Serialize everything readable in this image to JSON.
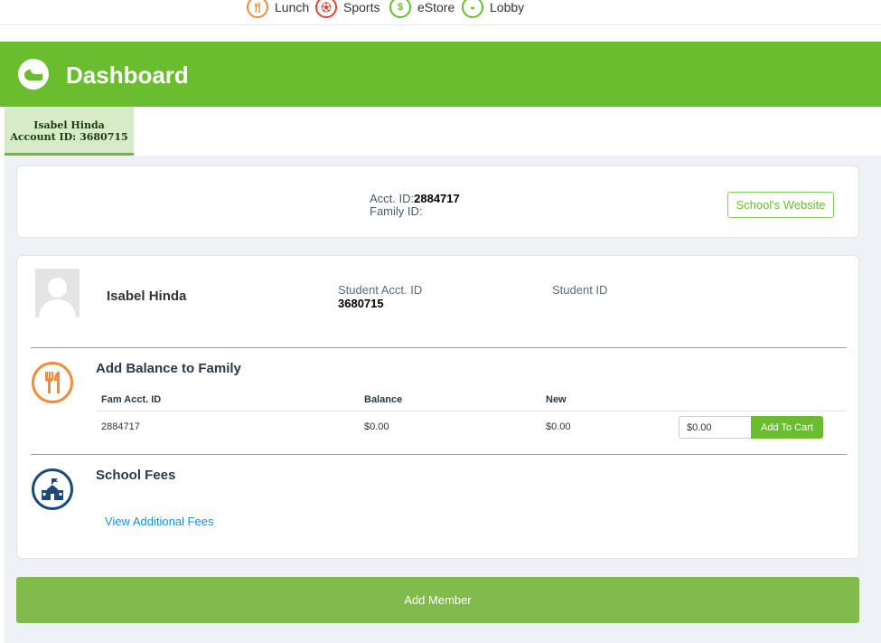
{
  "topnav": {
    "items": [
      {
        "label": "Lunch",
        "icon": "fork-knife-icon",
        "color": "#f28c38"
      },
      {
        "label": "Sports",
        "icon": "soccer-ball-icon",
        "color": "#e0453a"
      },
      {
        "label": "eStore",
        "icon": "dollar-bill-icon",
        "color": "#6abd2f"
      },
      {
        "label": "Lobby",
        "icon": "lobby-logo-icon",
        "color": "#6abd2f"
      }
    ]
  },
  "header": {
    "title": "Dashboard",
    "color": "#6abd2f"
  },
  "tab": {
    "name": "Isabel Hinda",
    "account": "Account ID: 3680715"
  },
  "account_card": {
    "acct_label": "Acct. ID:",
    "acct_value": "2884717",
    "family_label": "Family ID:",
    "website_button": "School's Website"
  },
  "student": {
    "name": "Isabel Hinda",
    "acct_label": "Student Acct. ID",
    "acct_value": "3680715",
    "student_id_label": "Student ID"
  },
  "balance": {
    "title": "Add Balance to Family",
    "columns": [
      "Fam Acct. ID",
      "Balance",
      "New"
    ],
    "row": {
      "fam_acct_id": "2884717",
      "balance": "$0.00",
      "new": "$0.00"
    },
    "amount_value": "$0.00",
    "add_to_cart": "Add To Cart"
  },
  "fees": {
    "title": "School Fees",
    "link": "View Additional Fees"
  },
  "add_member": "Add Member"
}
